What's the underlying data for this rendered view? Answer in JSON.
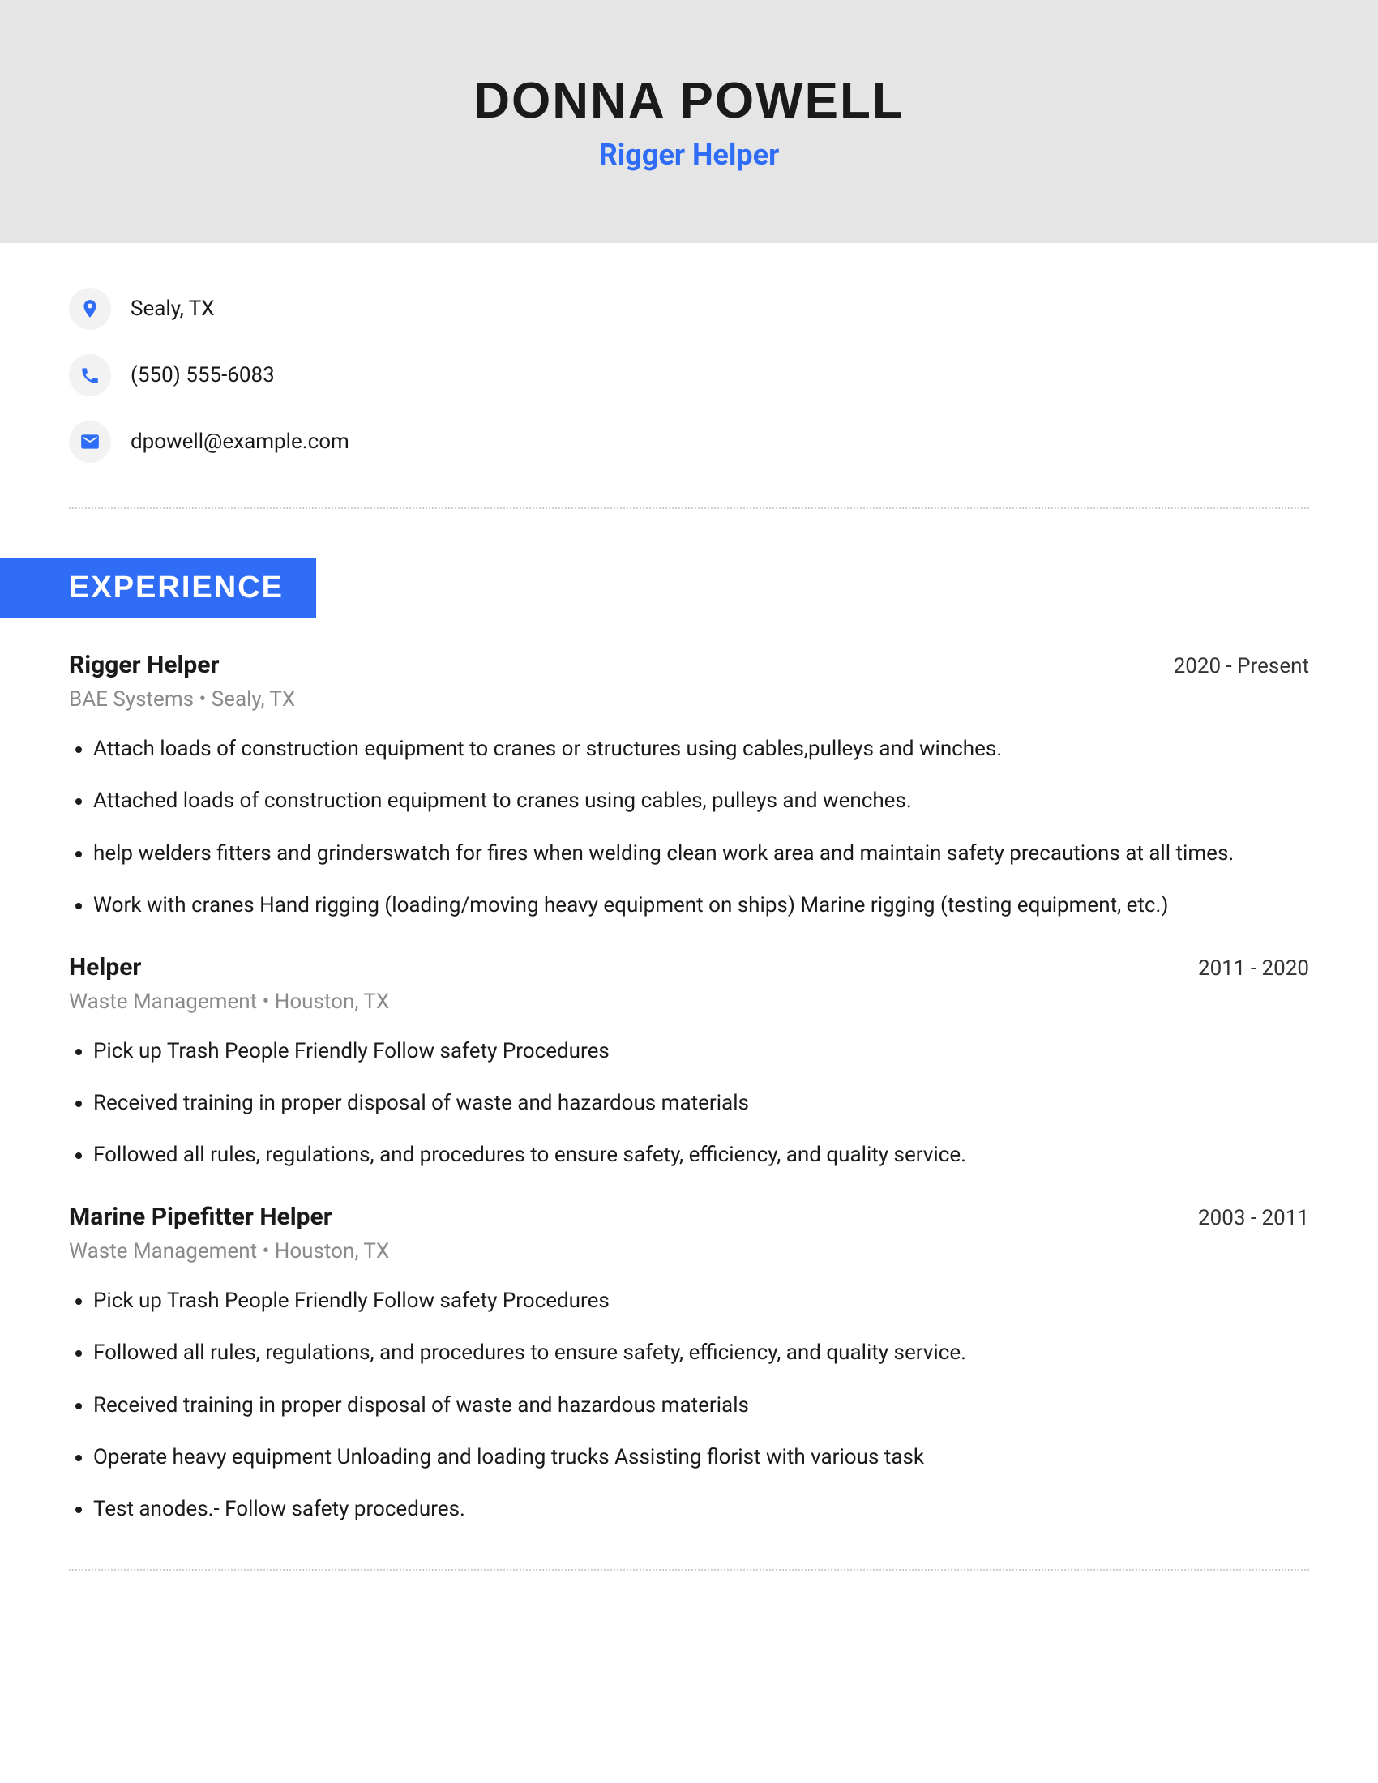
{
  "header": {
    "name": "DONNA POWELL",
    "title": "Rigger Helper"
  },
  "contact": {
    "location": "Sealy, TX",
    "phone": "(550) 555-6083",
    "email": "dpowell@example.com"
  },
  "sections": {
    "experience_label": "EXPERIENCE"
  },
  "experience": [
    {
      "title": "Rigger Helper",
      "dates": "2020 - Present",
      "company": "BAE Systems",
      "location": "Sealy, TX",
      "bullets": [
        "Attach loads of construction equipment to cranes or structures using cables,pulleys and winches.",
        "Attached loads of construction equipment to cranes using cables, pulleys and wenches.",
        "help welders fitters and grinderswatch for fires when welding clean work area and maintain safety precautions at all times.",
        "Work with cranes Hand rigging (loading/moving heavy equipment on ships) Marine rigging (testing equipment, etc.)"
      ]
    },
    {
      "title": "Helper",
      "dates": "2011 - 2020",
      "company": "Waste Management",
      "location": "Houston, TX",
      "bullets": [
        "Pick up Trash People Friendly Follow safety Procedures",
        "Received training in proper disposal of waste and hazardous materials",
        "Followed all rules, regulations, and procedures to ensure safety, efficiency, and quality service."
      ]
    },
    {
      "title": "Marine Pipefitter Helper",
      "dates": "2003 - 2011",
      "company": "Waste Management",
      "location": "Houston, TX",
      "bullets": [
        "Pick up Trash People Friendly Follow safety Procedures",
        "Followed all rules, regulations, and procedures to ensure safety, efficiency, and quality service.",
        "Received training in proper disposal of waste and hazardous materials",
        "Operate heavy equipment Unloading and loading trucks Assisting florist with various task",
        "Test anodes.- Follow safety procedures."
      ]
    }
  ]
}
